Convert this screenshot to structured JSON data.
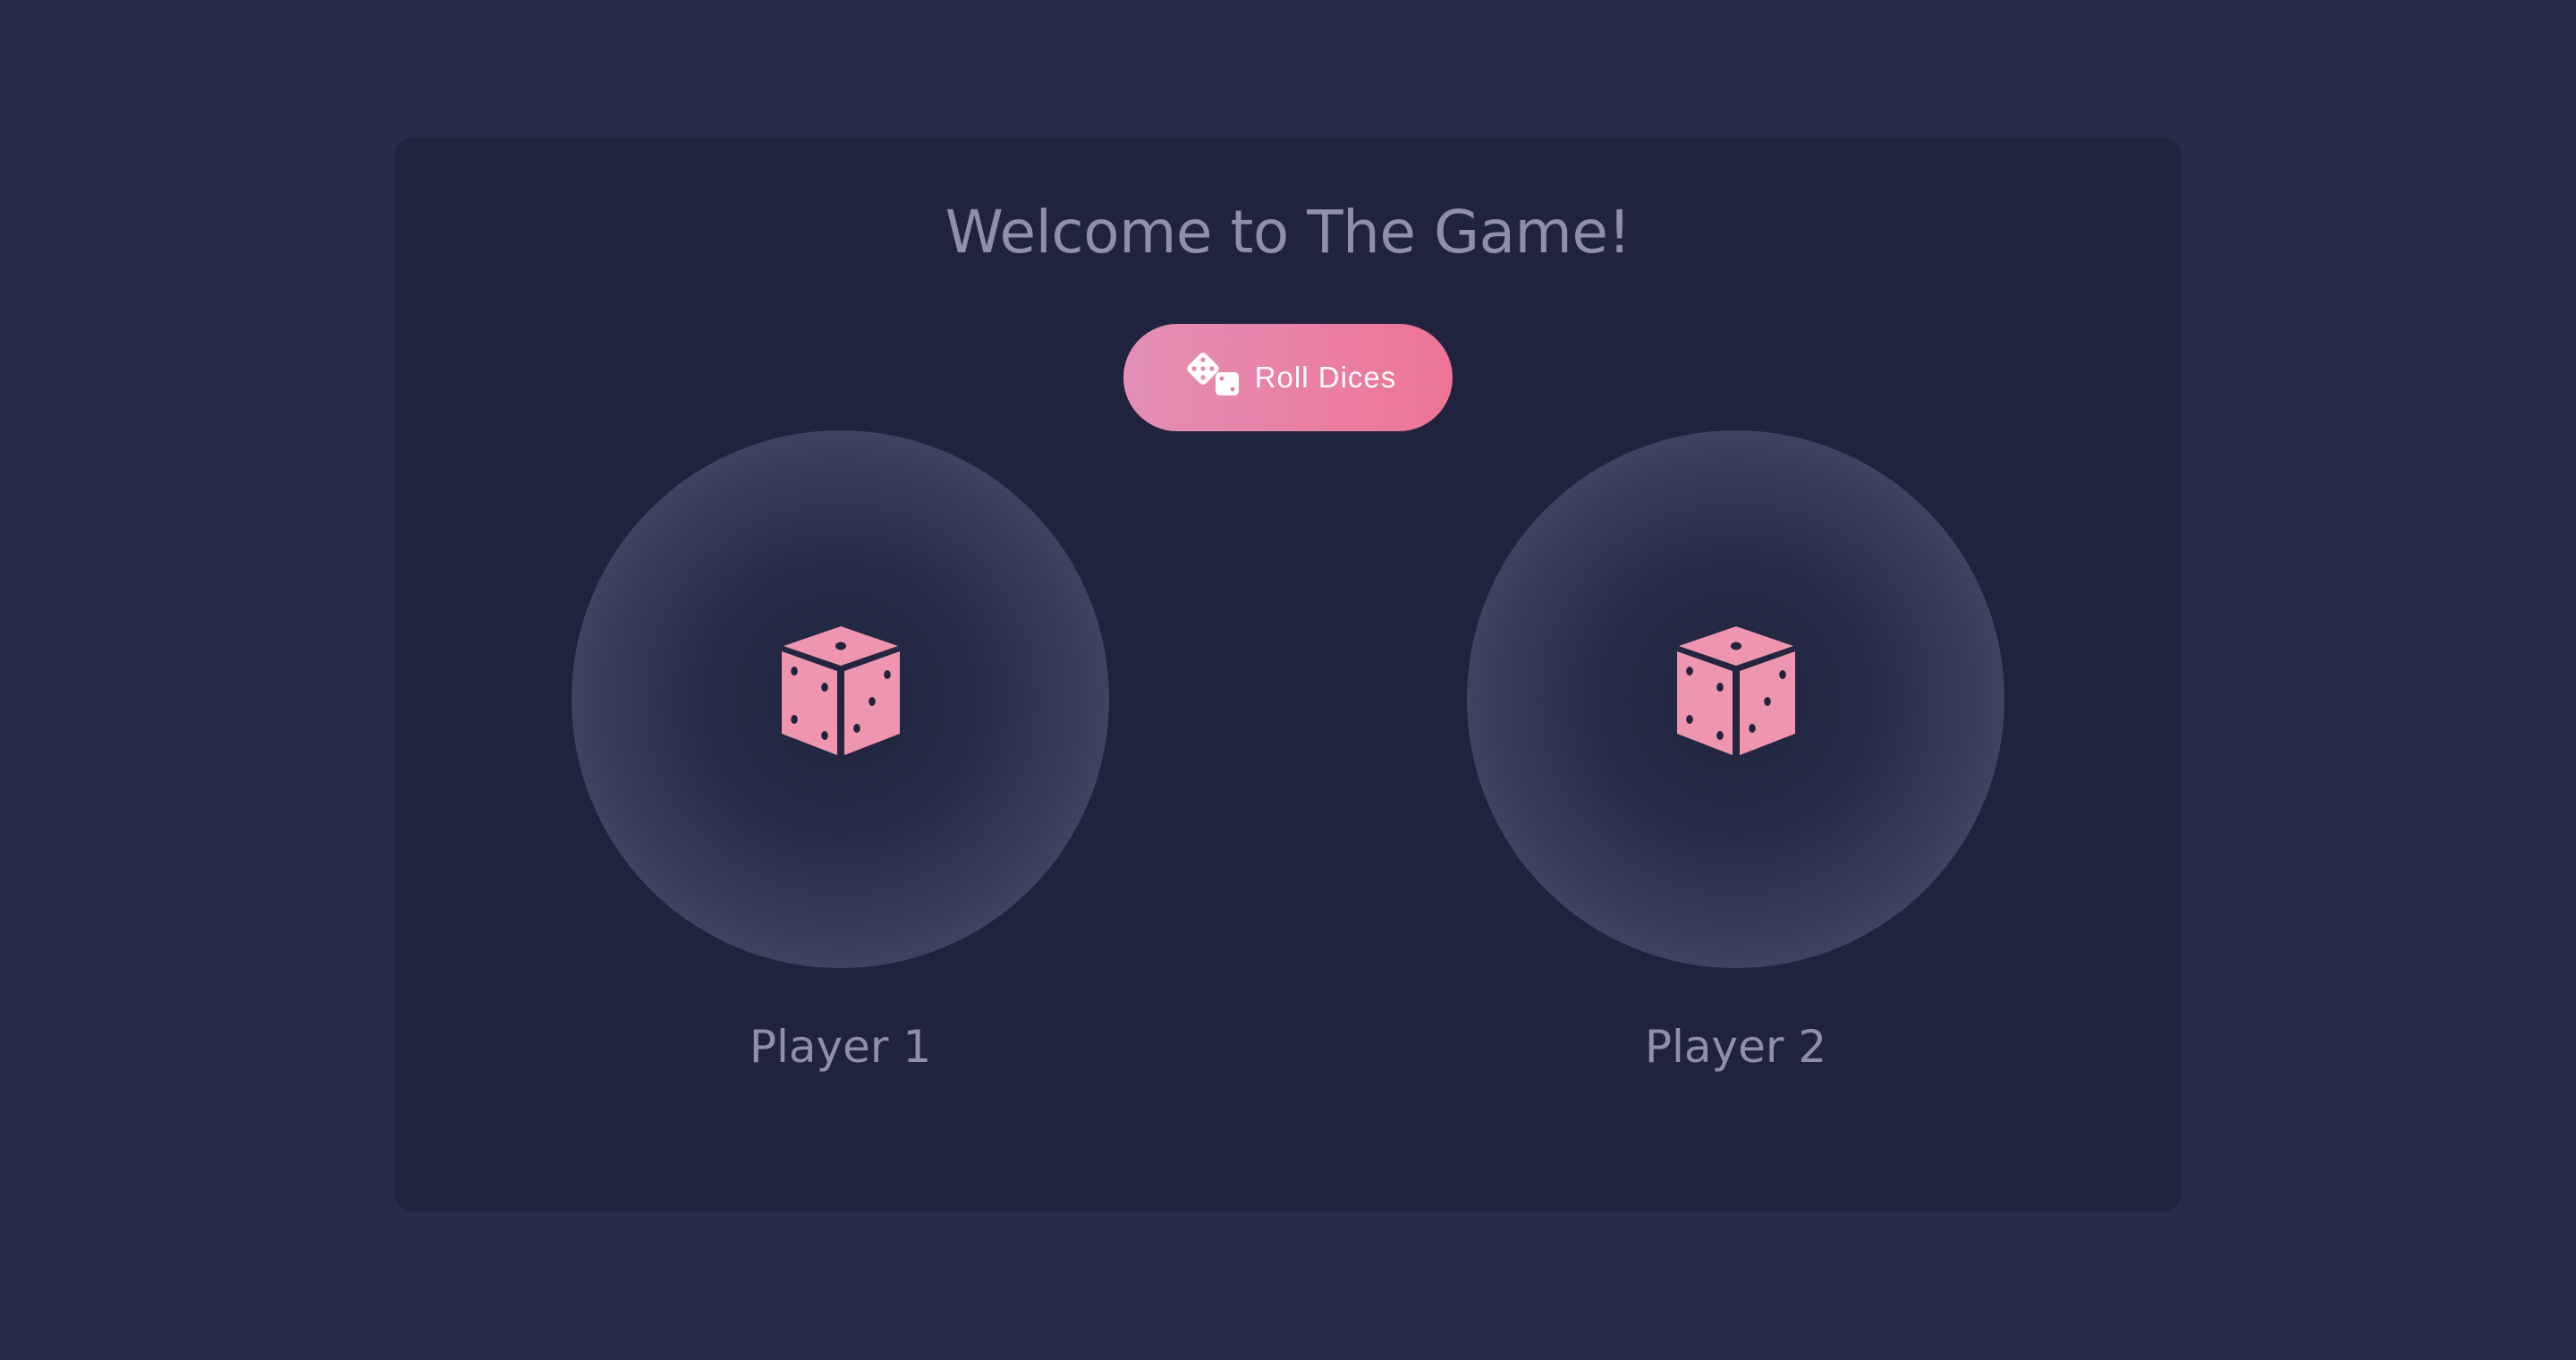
{
  "header": {
    "title": "Welcome to The Game!"
  },
  "roll_button": {
    "label": "Roll Dices",
    "icon": "dice-pair-icon"
  },
  "players": [
    {
      "label": "Player 1",
      "die_icon": "die-icon"
    },
    {
      "label": "Player 2",
      "die_icon": "die-icon"
    }
  ],
  "colors": {
    "page_background": "#252c47",
    "panel_background": "#1f233d",
    "text_muted": "#8d90a7",
    "accent_pink": "#ed7495",
    "accent_pink_light": "#e48fb6",
    "die_pink": "#f095b0"
  }
}
